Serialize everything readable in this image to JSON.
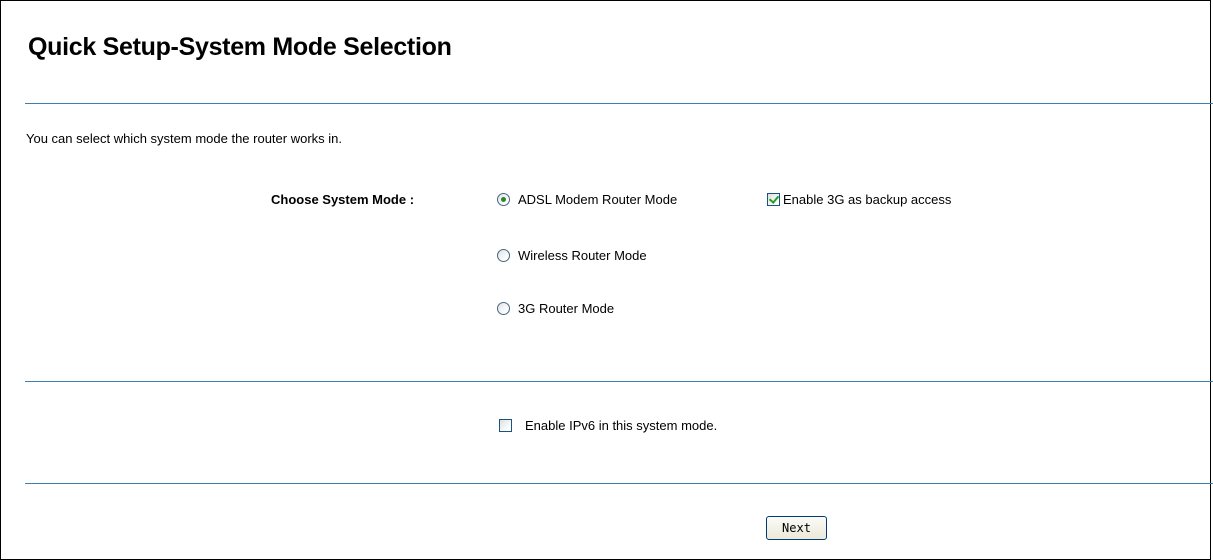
{
  "header": {
    "title": "Quick Setup-System Mode Selection"
  },
  "main": {
    "intro": "You can select which system mode the router works in.",
    "mode_label": "Choose System Mode :",
    "modes": [
      {
        "label": "ADSL Modem Router Mode",
        "selected": true
      },
      {
        "label": "Wireless Router Mode",
        "selected": false
      },
      {
        "label": "3G Router Mode",
        "selected": false
      }
    ],
    "backup_option": {
      "label": "Enable 3G as backup access",
      "checked": true
    },
    "ipv6_option": {
      "label": "Enable IPv6 in this system mode.",
      "checked": false
    }
  },
  "footer": {
    "next_label": "Next"
  },
  "colors": {
    "divider": "#3f7fb0",
    "check_green": "#21a121",
    "radio_dot": "#2a8a2a"
  }
}
